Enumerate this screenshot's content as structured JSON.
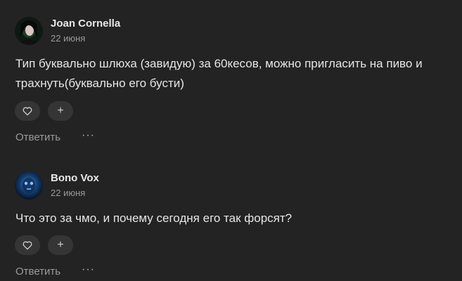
{
  "comments": [
    {
      "author": "Joan Cornella",
      "date": "22 июня",
      "text": "Тип буквально шлюха (завидую) за 60кесов, можно пригласить на пиво и трахнуть(буквально его бусти)",
      "reply_label": "Ответить",
      "more_label": "···",
      "plus_label": "+"
    },
    {
      "author": "Bono Vox",
      "date": "22 июня",
      "text": "Что это за чмо, и почему сегодня его так форсят?",
      "reply_label": "Ответить",
      "more_label": "···",
      "plus_label": "+"
    }
  ],
  "colors": {
    "background": "#232324",
    "text": "#e6e6e6",
    "muted": "#9a9a9a",
    "button_bg": "#353536"
  }
}
